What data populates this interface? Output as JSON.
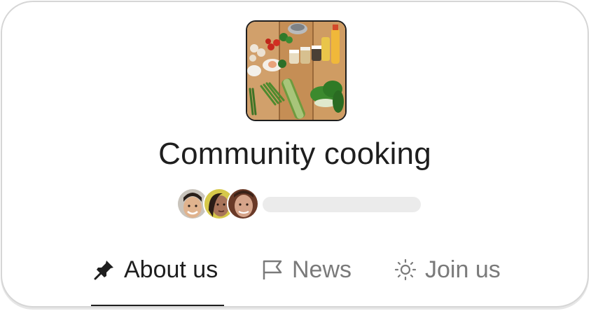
{
  "group": {
    "title": "Community cooking",
    "cover_icon": "food-ingredients-photo",
    "member_avatars": [
      "avatar-man-smiling",
      "avatar-woman",
      "avatar-man-older"
    ]
  },
  "tabs": [
    {
      "label": "About us",
      "icon": "pin-icon",
      "active": true
    },
    {
      "label": "News",
      "icon": "flag-icon",
      "active": false
    },
    {
      "label": "Join us",
      "icon": "sun-icon",
      "active": false
    }
  ],
  "colors": {
    "text": "#1e1e1e",
    "muted": "#7a7a7a",
    "border": "#d6d6d6",
    "placeholder": "#ebebeb"
  }
}
